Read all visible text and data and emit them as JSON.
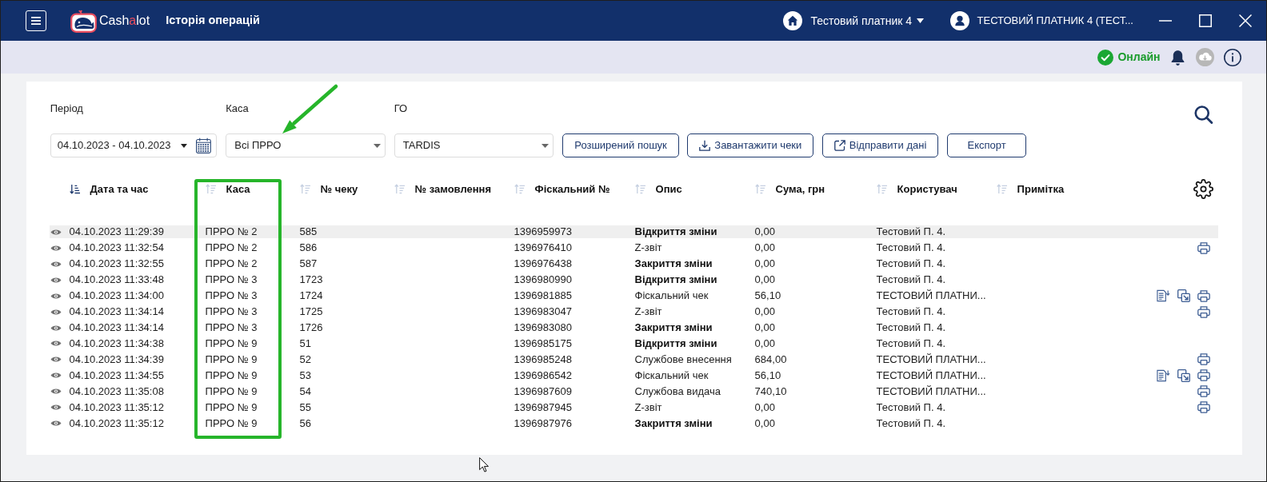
{
  "window": {
    "title": "Історія операцій"
  },
  "logo": {
    "prefix": "Cash",
    "accent": "a",
    "suffix": "lot"
  },
  "account": {
    "company": "Тестовий платник 4",
    "user": "ТЕСТОВИЙ ПЛАТНИК 4 (ТЕСТ..."
  },
  "status_bar": {
    "connection": "Онлайн"
  },
  "filters": [
    {
      "kind": "date",
      "label": "Період",
      "value": "04.10.2023 - 04.10.2023"
    },
    {
      "kind": "select",
      "label": "Каса",
      "value": "Всі ПРРО"
    },
    {
      "kind": "select",
      "label": "ГО",
      "value": "TARDIS"
    }
  ],
  "buttons": [
    {
      "kind": "plain",
      "label": "Розширений пошук"
    },
    {
      "kind": "download",
      "label": "Завантажити чеки"
    },
    {
      "kind": "send",
      "label": "Відправити дані"
    },
    {
      "kind": "plain",
      "label": "Експорт"
    }
  ],
  "table": {
    "columns": [
      {
        "label": "Дата та час",
        "sorted": true
      },
      {
        "label": "Каса",
        "sorted": false
      },
      {
        "label": "№ чеку",
        "sorted": false
      },
      {
        "label": "№ замовлення",
        "sorted": false
      },
      {
        "label": "Фіскальний №",
        "sorted": false
      },
      {
        "label": "Опис",
        "sorted": false
      },
      {
        "label": "Сума, грн",
        "sorted": false
      },
      {
        "label": "Користувач",
        "sorted": false
      },
      {
        "label": "Примітка",
        "sorted": false
      }
    ],
    "rows": [
      {
        "kind": "shift",
        "selected": true,
        "date": "04.10.2023 11:29:39",
        "cash_register": "ПРРО № 2",
        "receipt_no": "585",
        "fiscal_no": "1396959973",
        "description": "Відкриття зміни",
        "amount": "0,00",
        "user": "Тестовий П. 4."
      },
      {
        "kind": "report",
        "selected": false,
        "date": "04.10.2023 11:32:54",
        "cash_register": "ПРРО № 2",
        "receipt_no": "586",
        "fiscal_no": "1396976410",
        "description": "Z-звіт",
        "amount": "0,00",
        "user": "Тестовий П. 4."
      },
      {
        "kind": "shift",
        "selected": false,
        "date": "04.10.2023 11:32:55",
        "cash_register": "ПРРО № 2",
        "receipt_no": "587",
        "fiscal_no": "1396976438",
        "description": "Закриття зміни",
        "amount": "0,00",
        "user": "Тестовий П. 4."
      },
      {
        "kind": "shift",
        "selected": false,
        "date": "04.10.2023 11:33:48",
        "cash_register": "ПРРО № 3",
        "receipt_no": "1723",
        "fiscal_no": "1396980990",
        "description": "Відкриття зміни",
        "amount": "0,00",
        "user": "Тестовий П. 4."
      },
      {
        "kind": "receipt",
        "selected": false,
        "date": "04.10.2023 11:34:00",
        "cash_register": "ПРРО № 3",
        "receipt_no": "1724",
        "fiscal_no": "1396981885",
        "description": "Фіскальний чек",
        "amount": "56,10",
        "user": "ТЕСТОВИЙ ПЛАТНИ..."
      },
      {
        "kind": "report",
        "selected": false,
        "date": "04.10.2023 11:34:14",
        "cash_register": "ПРРО № 3",
        "receipt_no": "1725",
        "fiscal_no": "1396983047",
        "description": "Z-звіт",
        "amount": "0,00",
        "user": "Тестовий П. 4."
      },
      {
        "kind": "shift",
        "selected": false,
        "date": "04.10.2023 11:34:14",
        "cash_register": "ПРРО № 3",
        "receipt_no": "1726",
        "fiscal_no": "1396983080",
        "description": "Закриття зміни",
        "amount": "0,00",
        "user": "Тестовий П. 4."
      },
      {
        "kind": "shift",
        "selected": false,
        "date": "04.10.2023 11:34:38",
        "cash_register": "ПРРО № 9",
        "receipt_no": "51",
        "fiscal_no": "1396985175",
        "description": "Відкриття зміни",
        "amount": "0,00",
        "user": "Тестовий П. 4."
      },
      {
        "kind": "report",
        "selected": false,
        "date": "04.10.2023 11:34:39",
        "cash_register": "ПРРО № 9",
        "receipt_no": "52",
        "fiscal_no": "1396985248",
        "description": "Службове внесення",
        "amount": "684,00",
        "user": "ТЕСТОВИЙ ПЛАТНИ..."
      },
      {
        "kind": "receipt",
        "selected": false,
        "date": "04.10.2023 11:34:55",
        "cash_register": "ПРРО № 9",
        "receipt_no": "53",
        "fiscal_no": "1396986542",
        "description": "Фіскальний чек",
        "amount": "56,10",
        "user": "ТЕСТОВИЙ ПЛАТНИ..."
      },
      {
        "kind": "report",
        "selected": false,
        "date": "04.10.2023 11:35:08",
        "cash_register": "ПРРО № 9",
        "receipt_no": "54",
        "fiscal_no": "1396987609",
        "description": "Службова видача",
        "amount": "740,10",
        "user": "ТЕСТОВИЙ ПЛАТНИ..."
      },
      {
        "kind": "report",
        "selected": false,
        "date": "04.10.2023 11:35:12",
        "cash_register": "ПРРО № 9",
        "receipt_no": "55",
        "fiscal_no": "1396987945",
        "description": "Z-звіт",
        "amount": "0,00",
        "user": "Тестовий П. 4."
      },
      {
        "kind": "shift",
        "selected": false,
        "date": "04.10.2023 11:35:12",
        "cash_register": "ПРРО № 9",
        "receipt_no": "56",
        "fiscal_no": "1396987976",
        "description": "Закриття зміни",
        "amount": "0,00",
        "user": "Тестовий П. 4."
      }
    ]
  }
}
